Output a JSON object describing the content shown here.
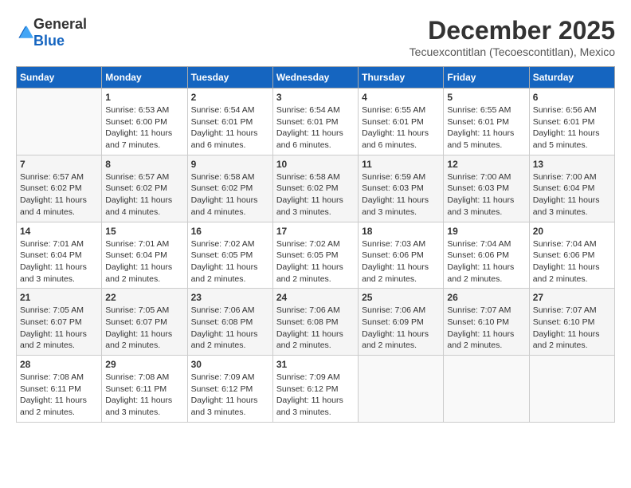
{
  "logo": {
    "text_general": "General",
    "text_blue": "Blue"
  },
  "title": "December 2025",
  "subtitle": "Tecuexcontitlan (Tecoescontitlan), Mexico",
  "weekdays": [
    "Sunday",
    "Monday",
    "Tuesday",
    "Wednesday",
    "Thursday",
    "Friday",
    "Saturday"
  ],
  "weeks": [
    [
      {
        "day": "",
        "sunrise": "",
        "sunset": "",
        "daylight": ""
      },
      {
        "day": "1",
        "sunrise": "Sunrise: 6:53 AM",
        "sunset": "Sunset: 6:00 PM",
        "daylight": "Daylight: 11 hours and 7 minutes."
      },
      {
        "day": "2",
        "sunrise": "Sunrise: 6:54 AM",
        "sunset": "Sunset: 6:01 PM",
        "daylight": "Daylight: 11 hours and 6 minutes."
      },
      {
        "day": "3",
        "sunrise": "Sunrise: 6:54 AM",
        "sunset": "Sunset: 6:01 PM",
        "daylight": "Daylight: 11 hours and 6 minutes."
      },
      {
        "day": "4",
        "sunrise": "Sunrise: 6:55 AM",
        "sunset": "Sunset: 6:01 PM",
        "daylight": "Daylight: 11 hours and 6 minutes."
      },
      {
        "day": "5",
        "sunrise": "Sunrise: 6:55 AM",
        "sunset": "Sunset: 6:01 PM",
        "daylight": "Daylight: 11 hours and 5 minutes."
      },
      {
        "day": "6",
        "sunrise": "Sunrise: 6:56 AM",
        "sunset": "Sunset: 6:01 PM",
        "daylight": "Daylight: 11 hours and 5 minutes."
      }
    ],
    [
      {
        "day": "7",
        "sunrise": "Sunrise: 6:57 AM",
        "sunset": "Sunset: 6:02 PM",
        "daylight": "Daylight: 11 hours and 4 minutes."
      },
      {
        "day": "8",
        "sunrise": "Sunrise: 6:57 AM",
        "sunset": "Sunset: 6:02 PM",
        "daylight": "Daylight: 11 hours and 4 minutes."
      },
      {
        "day": "9",
        "sunrise": "Sunrise: 6:58 AM",
        "sunset": "Sunset: 6:02 PM",
        "daylight": "Daylight: 11 hours and 4 minutes."
      },
      {
        "day": "10",
        "sunrise": "Sunrise: 6:58 AM",
        "sunset": "Sunset: 6:02 PM",
        "daylight": "Daylight: 11 hours and 3 minutes."
      },
      {
        "day": "11",
        "sunrise": "Sunrise: 6:59 AM",
        "sunset": "Sunset: 6:03 PM",
        "daylight": "Daylight: 11 hours and 3 minutes."
      },
      {
        "day": "12",
        "sunrise": "Sunrise: 7:00 AM",
        "sunset": "Sunset: 6:03 PM",
        "daylight": "Daylight: 11 hours and 3 minutes."
      },
      {
        "day": "13",
        "sunrise": "Sunrise: 7:00 AM",
        "sunset": "Sunset: 6:04 PM",
        "daylight": "Daylight: 11 hours and 3 minutes."
      }
    ],
    [
      {
        "day": "14",
        "sunrise": "Sunrise: 7:01 AM",
        "sunset": "Sunset: 6:04 PM",
        "daylight": "Daylight: 11 hours and 3 minutes."
      },
      {
        "day": "15",
        "sunrise": "Sunrise: 7:01 AM",
        "sunset": "Sunset: 6:04 PM",
        "daylight": "Daylight: 11 hours and 2 minutes."
      },
      {
        "day": "16",
        "sunrise": "Sunrise: 7:02 AM",
        "sunset": "Sunset: 6:05 PM",
        "daylight": "Daylight: 11 hours and 2 minutes."
      },
      {
        "day": "17",
        "sunrise": "Sunrise: 7:02 AM",
        "sunset": "Sunset: 6:05 PM",
        "daylight": "Daylight: 11 hours and 2 minutes."
      },
      {
        "day": "18",
        "sunrise": "Sunrise: 7:03 AM",
        "sunset": "Sunset: 6:06 PM",
        "daylight": "Daylight: 11 hours and 2 minutes."
      },
      {
        "day": "19",
        "sunrise": "Sunrise: 7:04 AM",
        "sunset": "Sunset: 6:06 PM",
        "daylight": "Daylight: 11 hours and 2 minutes."
      },
      {
        "day": "20",
        "sunrise": "Sunrise: 7:04 AM",
        "sunset": "Sunset: 6:06 PM",
        "daylight": "Daylight: 11 hours and 2 minutes."
      }
    ],
    [
      {
        "day": "21",
        "sunrise": "Sunrise: 7:05 AM",
        "sunset": "Sunset: 6:07 PM",
        "daylight": "Daylight: 11 hours and 2 minutes."
      },
      {
        "day": "22",
        "sunrise": "Sunrise: 7:05 AM",
        "sunset": "Sunset: 6:07 PM",
        "daylight": "Daylight: 11 hours and 2 minutes."
      },
      {
        "day": "23",
        "sunrise": "Sunrise: 7:06 AM",
        "sunset": "Sunset: 6:08 PM",
        "daylight": "Daylight: 11 hours and 2 minutes."
      },
      {
        "day": "24",
        "sunrise": "Sunrise: 7:06 AM",
        "sunset": "Sunset: 6:08 PM",
        "daylight": "Daylight: 11 hours and 2 minutes."
      },
      {
        "day": "25",
        "sunrise": "Sunrise: 7:06 AM",
        "sunset": "Sunset: 6:09 PM",
        "daylight": "Daylight: 11 hours and 2 minutes."
      },
      {
        "day": "26",
        "sunrise": "Sunrise: 7:07 AM",
        "sunset": "Sunset: 6:10 PM",
        "daylight": "Daylight: 11 hours and 2 minutes."
      },
      {
        "day": "27",
        "sunrise": "Sunrise: 7:07 AM",
        "sunset": "Sunset: 6:10 PM",
        "daylight": "Daylight: 11 hours and 2 minutes."
      }
    ],
    [
      {
        "day": "28",
        "sunrise": "Sunrise: 7:08 AM",
        "sunset": "Sunset: 6:11 PM",
        "daylight": "Daylight: 11 hours and 2 minutes."
      },
      {
        "day": "29",
        "sunrise": "Sunrise: 7:08 AM",
        "sunset": "Sunset: 6:11 PM",
        "daylight": "Daylight: 11 hours and 3 minutes."
      },
      {
        "day": "30",
        "sunrise": "Sunrise: 7:09 AM",
        "sunset": "Sunset: 6:12 PM",
        "daylight": "Daylight: 11 hours and 3 minutes."
      },
      {
        "day": "31",
        "sunrise": "Sunrise: 7:09 AM",
        "sunset": "Sunset: 6:12 PM",
        "daylight": "Daylight: 11 hours and 3 minutes."
      },
      {
        "day": "",
        "sunrise": "",
        "sunset": "",
        "daylight": ""
      },
      {
        "day": "",
        "sunrise": "",
        "sunset": "",
        "daylight": ""
      },
      {
        "day": "",
        "sunrise": "",
        "sunset": "",
        "daylight": ""
      }
    ]
  ]
}
